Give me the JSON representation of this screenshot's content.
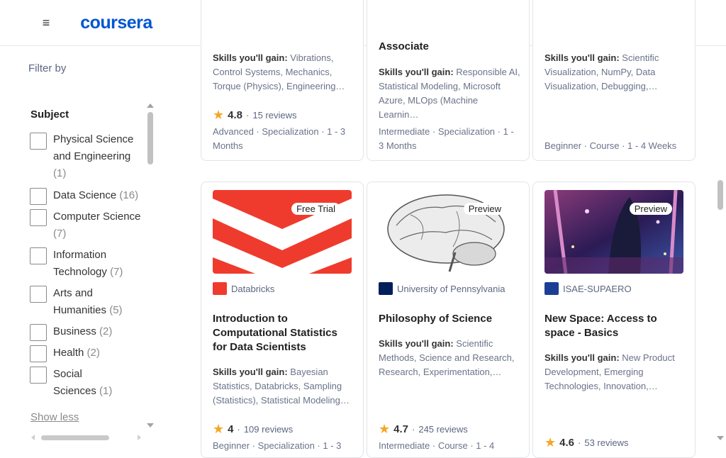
{
  "header": {
    "logo_text": "coursera",
    "menu_icon": "hamburger-icon"
  },
  "filters": {
    "title": "Filter by",
    "subject_heading": "Subject",
    "items": [
      {
        "label": "Physical Science and Engineering",
        "count": "(1)"
      },
      {
        "label": "Data Science",
        "count": "(16)"
      },
      {
        "label": "Computer Science",
        "count": "(7)"
      },
      {
        "label": "Information Technology",
        "count": "(7)"
      },
      {
        "label": "Arts and Humanities",
        "count": "(5)"
      },
      {
        "label": "Business",
        "count": "(2)"
      },
      {
        "label": "Health",
        "count": "(2)"
      },
      {
        "label": "Social Sciences",
        "count": "(1)"
      }
    ],
    "show_less": "Show less"
  },
  "cards_top": [
    {
      "title": "",
      "skills_label": "Skills you'll gain:",
      "skills": "Vibrations, Control Systems, Mechanics, Torque (Physics), Engineering…",
      "rating": "4.8",
      "reviews": "15 reviews",
      "meta": "Advanced · Specialization · 1 - 3 Months"
    },
    {
      "title": "Associate",
      "skills_label": "Skills you'll gain:",
      "skills": "Responsible AI, Statistical Modeling, Microsoft Azure, MLOps (Machine Learnin…",
      "meta": "Intermediate · Specialization · 1 - 3 Months"
    },
    {
      "skills_label": "Skills you'll gain:",
      "skills": "Scientific Visualization, NumPy, Data Visualization, Debugging,…",
      "meta": "Beginner · Course · 1 - 4 Weeks"
    }
  ],
  "cards_bottom": [
    {
      "badge": "Free Trial",
      "partner": "Databricks",
      "title": "Introduction to Computational Statistics for Data Scientists",
      "skills_label": "Skills you'll gain:",
      "skills": "Bayesian Statistics, Databricks, Sampling (Statistics), Statistical Modeling…",
      "rating": "4",
      "reviews": "109 reviews",
      "meta": "Beginner · Specialization · 1 - 3"
    },
    {
      "badge": "Preview",
      "partner": "University of Pennsylvania",
      "title": "Philosophy of Science",
      "skills_label": "Skills you'll gain:",
      "skills": "Scientific Methods, Science and Research, Research, Experimentation,…",
      "rating": "4.7",
      "reviews": "245 reviews",
      "meta": "Intermediate · Course · 1 - 4"
    },
    {
      "badge": "Preview",
      "partner": "ISAE-SUPAERO",
      "title": "New Space: Access to space - Basics",
      "skills_label": "Skills you'll gain:",
      "skills": "New Product Development, Emerging Technologies, Innovation,…",
      "rating": "4.6",
      "reviews": "53 reviews"
    }
  ],
  "colors": {
    "brand": "#0056d2",
    "star": "#f5a623"
  }
}
